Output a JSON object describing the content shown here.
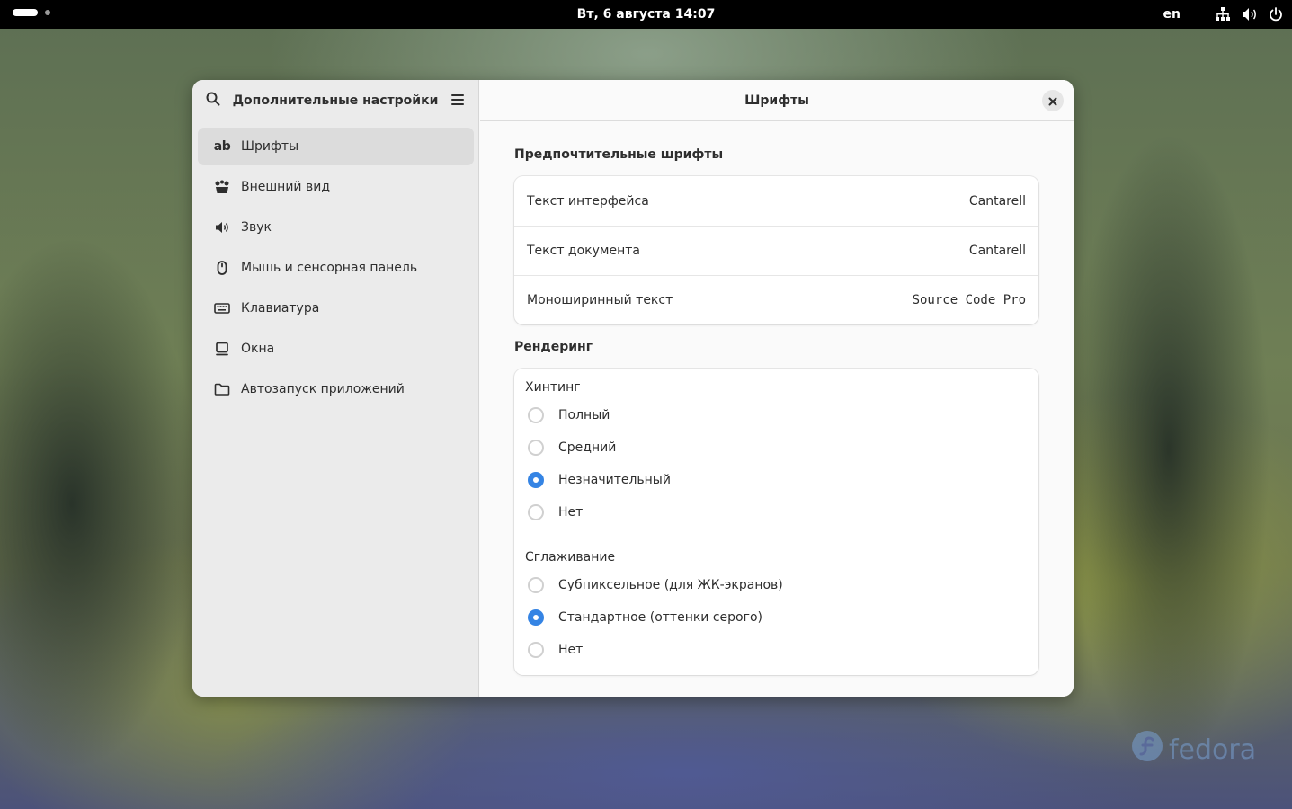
{
  "topbar": {
    "datetime": "Вт, 6 августа  14:07",
    "language": "en",
    "icons": [
      "network-icon",
      "volume-icon",
      "power-icon"
    ]
  },
  "window": {
    "sidebar": {
      "title": "Дополнительные настройки",
      "items": [
        {
          "label": "Шрифты",
          "icon": "ab",
          "active": true
        },
        {
          "label": "Внешний вид",
          "icon": "appearance-icon"
        },
        {
          "label": "Звук",
          "icon": "sound-icon"
        },
        {
          "label": "Мышь и сенсорная панель",
          "icon": "mouse-icon"
        },
        {
          "label": "Клавиатура",
          "icon": "keyboard-icon"
        },
        {
          "label": "Окна",
          "icon": "window-icon"
        },
        {
          "label": "Автозапуск приложений",
          "icon": "folder-icon"
        }
      ]
    },
    "content": {
      "title": "Шрифты",
      "preferred": {
        "title": "Предпочтительные шрифты",
        "rows": [
          {
            "label": "Текст интерфейса",
            "value": "Cantarell"
          },
          {
            "label": "Текст документа",
            "value": "Cantarell"
          },
          {
            "label": "Моноширинный текст",
            "value": "Source Code Pro"
          }
        ]
      },
      "rendering": {
        "title": "Рендеринг",
        "hinting": {
          "label": "Хинтинг",
          "options": [
            "Полный",
            "Средний",
            "Незначительный",
            "Нет"
          ],
          "selected": "Незначительный"
        },
        "antialiasing": {
          "label": "Сглаживание",
          "options": [
            "Субпиксельное (для ЖК-экранов)",
            "Стандартное (оттенки серого)",
            "Нет"
          ],
          "selected": "Стандартное (оттенки серого)"
        }
      }
    }
  },
  "desktop": {
    "logo_text": "fedora",
    "accent_color": "#3584e4"
  }
}
